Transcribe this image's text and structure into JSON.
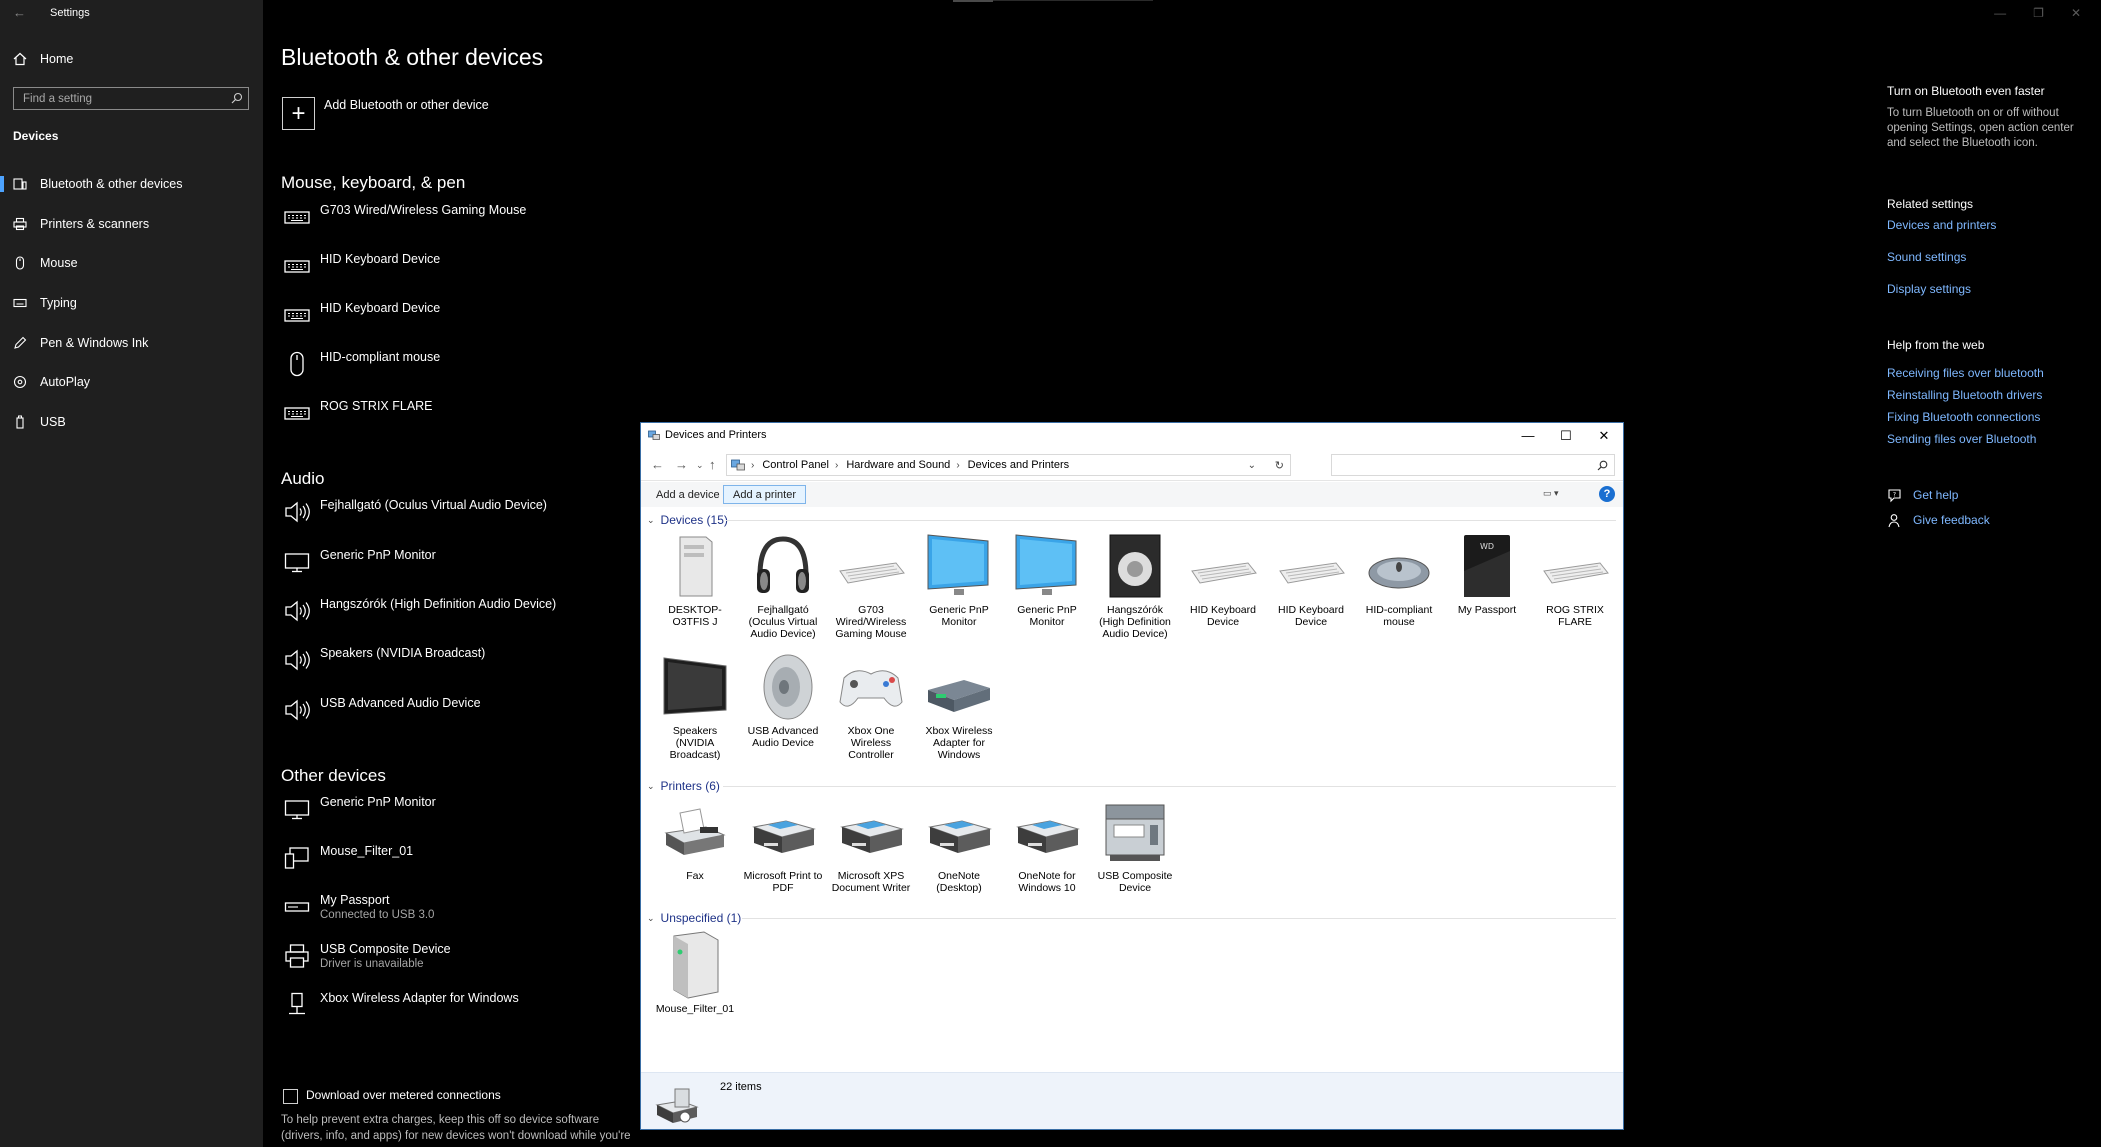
{
  "settings": {
    "window_title": "Settings",
    "nav": {
      "home": "Home",
      "search_placeholder": "Find a setting",
      "section": "Devices",
      "items": [
        {
          "label": "Bluetooth & other devices",
          "icon": "bluetooth-devices-icon",
          "selected": true
        },
        {
          "label": "Printers & scanners",
          "icon": "printer-icon",
          "selected": false
        },
        {
          "label": "Mouse",
          "icon": "mouse-icon",
          "selected": false
        },
        {
          "label": "Typing",
          "icon": "keyboard-icon",
          "selected": false
        },
        {
          "label": "Pen & Windows Ink",
          "icon": "pen-icon",
          "selected": false
        },
        {
          "label": "AutoPlay",
          "icon": "autoplay-icon",
          "selected": false
        },
        {
          "label": "USB",
          "icon": "usb-icon",
          "selected": false
        }
      ]
    },
    "main": {
      "title": "Bluetooth & other devices",
      "add_device": "Add Bluetooth or other device",
      "sections": {
        "mouse_keyboard_pen": {
          "title": "Mouse, keyboard, & pen",
          "devices": [
            {
              "name": "G703 Wired/Wireless Gaming Mouse",
              "icon": "keyboard-icon"
            },
            {
              "name": "HID Keyboard Device",
              "icon": "keyboard-icon"
            },
            {
              "name": "HID Keyboard Device",
              "icon": "keyboard-icon"
            },
            {
              "name": "HID-compliant mouse",
              "icon": "mouse-icon"
            },
            {
              "name": "ROG STRIX FLARE",
              "icon": "keyboard-icon"
            }
          ]
        },
        "audio": {
          "title": "Audio",
          "devices": [
            {
              "name": "Fejhallgató (Oculus Virtual Audio Device)",
              "icon": "speaker-icon"
            },
            {
              "name": "Generic PnP Monitor",
              "icon": "monitor-icon"
            },
            {
              "name": "Hangszórók (High Definition Audio Device)",
              "icon": "speaker-icon"
            },
            {
              "name": "Speakers (NVIDIA Broadcast)",
              "icon": "speaker-icon"
            },
            {
              "name": "USB Advanced Audio Device",
              "icon": "speaker-icon"
            }
          ]
        },
        "other": {
          "title": "Other devices",
          "devices": [
            {
              "name": "Generic PnP Monitor",
              "sub": "",
              "icon": "monitor-icon"
            },
            {
              "name": "Mouse_Filter_01",
              "sub": "",
              "icon": "devices-icon"
            },
            {
              "name": "My Passport",
              "sub": "Connected to USB 3.0",
              "icon": "drive-icon"
            },
            {
              "name": "USB Composite Device",
              "sub": "Driver is unavailable",
              "icon": "printer-icon"
            },
            {
              "name": "Xbox Wireless Adapter for Windows",
              "sub": "",
              "icon": "usb-adapter-icon"
            }
          ]
        }
      },
      "metered": {
        "label": "Download over metered connections",
        "help": "To help prevent extra charges, keep this off so device software (drivers, info, and apps) for new devices won't download while you're on"
      }
    },
    "right": {
      "tip_heading": "Turn on Bluetooth even faster",
      "tip_text": "To turn Bluetooth on or off without opening Settings, open action center and select the Bluetooth icon.",
      "related_heading": "Related settings",
      "related_links": [
        "Devices and printers",
        "Sound settings",
        "Display settings"
      ],
      "help_heading": "Help from the web",
      "help_links": [
        "Receiving files over bluetooth",
        "Reinstalling Bluetooth drivers",
        "Fixing Bluetooth connections",
        "Sending files over Bluetooth"
      ],
      "get_help": "Get help",
      "give_feedback": "Give feedback"
    }
  },
  "devices_printers": {
    "title": "Devices and Printers",
    "breadcrumbs": [
      "Control Panel",
      "Hardware and Sound",
      "Devices and Printers"
    ],
    "search_placeholder": "",
    "toolbar": {
      "add_device": "Add a device",
      "add_printer": "Add a printer",
      "help": "?"
    },
    "groups": {
      "devices": {
        "title": "Devices (15)",
        "items": [
          {
            "label": "DESKTOP-O3TFIS J",
            "icon": "computer-tower-icon"
          },
          {
            "label": "Fejhallgató (Oculus Virtual Audio Device)",
            "icon": "headphones-icon"
          },
          {
            "label": "G703 Wired/Wireless Gaming Mouse",
            "icon": "keyboard-icon"
          },
          {
            "label": "Generic PnP Monitor",
            "icon": "monitor-icon"
          },
          {
            "label": "Generic PnP Monitor",
            "icon": "monitor-icon"
          },
          {
            "label": "Hangszórók (High Definition Audio Device)",
            "icon": "speaker-box-icon"
          },
          {
            "label": "HID Keyboard Device",
            "icon": "keyboard-icon"
          },
          {
            "label": "HID Keyboard Device",
            "icon": "keyboard-icon"
          },
          {
            "label": "HID-compliant mouse",
            "icon": "mouse-icon"
          },
          {
            "label": "My Passport",
            "icon": "drive-icon"
          },
          {
            "label": "ROG STRIX FLARE",
            "icon": "keyboard-icon"
          },
          {
            "label": "Speakers (NVIDIA Broadcast)",
            "icon": "tv-icon"
          },
          {
            "label": "USB Advanced Audio Device",
            "icon": "speaker-cone-icon"
          },
          {
            "label": "Xbox One Wireless Controller",
            "icon": "gamepad-icon"
          },
          {
            "label": "Xbox Wireless Adapter for Windows",
            "icon": "network-adapter-icon"
          }
        ]
      },
      "printers": {
        "title": "Printers (6)",
        "items": [
          {
            "label": "Fax",
            "icon": "fax-icon"
          },
          {
            "label": "Microsoft Print to PDF",
            "icon": "printer-icon"
          },
          {
            "label": "Microsoft XPS Document Writer",
            "icon": "printer-icon"
          },
          {
            "label": "OneNote (Desktop)",
            "icon": "printer-icon"
          },
          {
            "label": "OneNote for Windows 10",
            "icon": "printer-icon"
          },
          {
            "label": "USB Composite Device",
            "icon": "multifunction-printer-icon"
          }
        ]
      },
      "unspecified": {
        "title": "Unspecified (1)",
        "items": [
          {
            "label": "Mouse_Filter_01",
            "icon": "computer-tower-icon"
          }
        ]
      }
    },
    "status": {
      "count": "22 items"
    }
  },
  "colors": {
    "accent": "#4da3ff",
    "link": "#7fb8ff",
    "sidebar_bg": "#1f1f1f",
    "group_header": "#1e3287"
  }
}
